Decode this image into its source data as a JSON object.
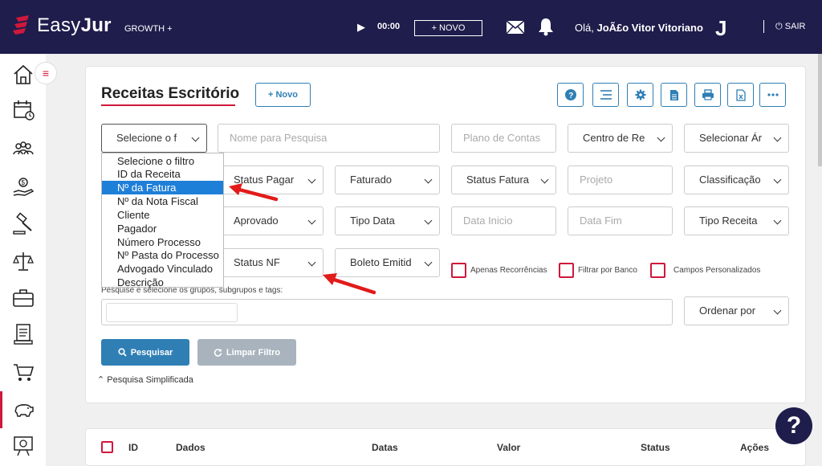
{
  "topbar": {
    "logo_prefix": "Easy",
    "logo_suffix": "Jur",
    "plan": "GROWTH +",
    "timer": "00:00",
    "new_button": "+ NOVO",
    "greeting_prefix": "Olá, ",
    "user_name": "JoÃ£o Vitor Vitoriano",
    "avatar_letter": "J",
    "logout": "SAIR"
  },
  "sidebar": {
    "items": [
      "home-icon",
      "calendar-icon",
      "people-icon",
      "money-hand-icon",
      "gavel-icon",
      "scales-icon",
      "briefcase-icon",
      "document-icon",
      "cart-icon",
      "piggy-bank-icon",
      "presentation-icon"
    ],
    "active": "piggy-bank-icon",
    "toggle": "≡"
  },
  "page": {
    "title": "Receitas Escritório",
    "new_button": "+ Novo"
  },
  "filters": {
    "filter_select": "Selecione o f",
    "search_name_placeholder": "Nome para Pesquisa",
    "plano_contas_placeholder": "Plano de Contas",
    "centro": "Centro de Re",
    "selecionar_area": "Selecionar Ár",
    "status_pagamento": "Status Pagar",
    "faturado": "Faturado",
    "status_fatura": "Status Fatura",
    "projeto_placeholder": "Projeto",
    "classificacao": "Classificação",
    "aprovado": "Aprovado",
    "tipo_data": "Tipo Data",
    "data_inicio_placeholder": "Data Inicio",
    "data_fim_placeholder": "Data Fim",
    "tipo_receita": "Tipo Receita",
    "status_nf": "Status NF",
    "boleto": "Boleto Emitid",
    "check_recorrencias": "Apenas Recorrências",
    "check_banco": "Filtrar por Banco",
    "check_campos": "Campos Personalizados",
    "tags_label": "Pesquise e selecione os grupos, subgrupos e tags:",
    "ordenar": "Ordenar por",
    "search_button": "Pesquisar",
    "clear_button": "Limpar Filtro",
    "simplified": "Pesquisa Simplificada"
  },
  "dropdown": {
    "options": [
      "Selecione o filtro",
      "ID da Receita",
      "Nº da Fatura",
      "Nº da Nota Fiscal",
      "Cliente",
      "Pagador",
      "Número Processo",
      "Nº Pasta do Processo",
      "Advogado Vinculado",
      "Descrição"
    ],
    "highlighted_index": 2
  },
  "table": {
    "headers": [
      "ID",
      "Dados",
      "Datas",
      "Valor",
      "Status",
      "Ações"
    ]
  },
  "help_button": "?",
  "colors": {
    "topbar": "#1f1d4c",
    "accent_red": "#d0183b",
    "primary_blue": "#2f7fb5",
    "highlight": "#1e7fd8"
  }
}
